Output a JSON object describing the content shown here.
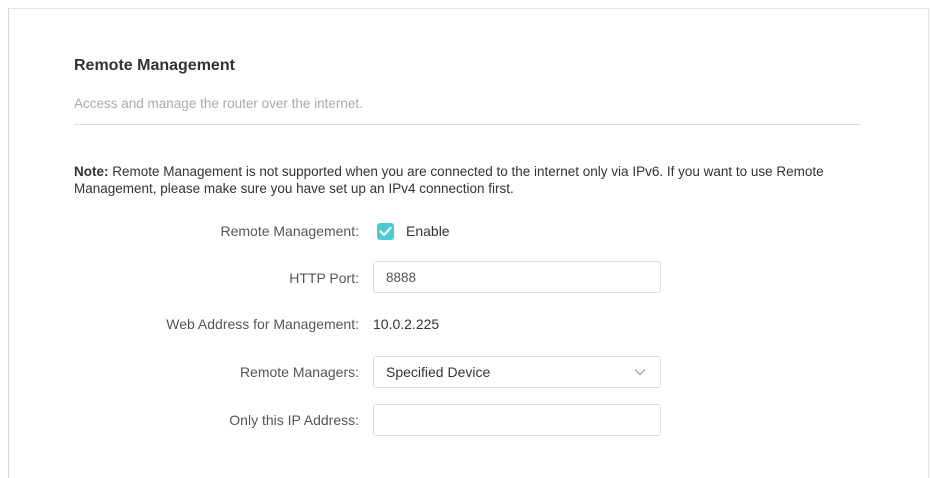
{
  "section": {
    "title": "Remote Management",
    "description": "Access and manage the router over the internet."
  },
  "note": {
    "prefix": "Note:",
    "text": " Remote Management is not supported when you are connected to the internet only via IPv6. If you want to use Remote Management, please make sure you have set up an IPv4 connection first."
  },
  "form": {
    "remote_management": {
      "label": "Remote Management:",
      "checkbox_label": "Enable",
      "checked": true
    },
    "http_port": {
      "label": "HTTP Port:",
      "value": "8888"
    },
    "web_address": {
      "label": "Web Address for Management:",
      "value": "10.0.2.225"
    },
    "remote_managers": {
      "label": "Remote Managers:",
      "selected": "Specified Device"
    },
    "only_ip": {
      "label": "Only this IP Address:",
      "value": ""
    }
  },
  "colors": {
    "accent": "#4acbd6",
    "border": "#dedede",
    "muted_text": "#aaaaaa"
  },
  "icons": {
    "checkbox": "checkmark-icon",
    "dropdown": "chevron-down-icon"
  }
}
